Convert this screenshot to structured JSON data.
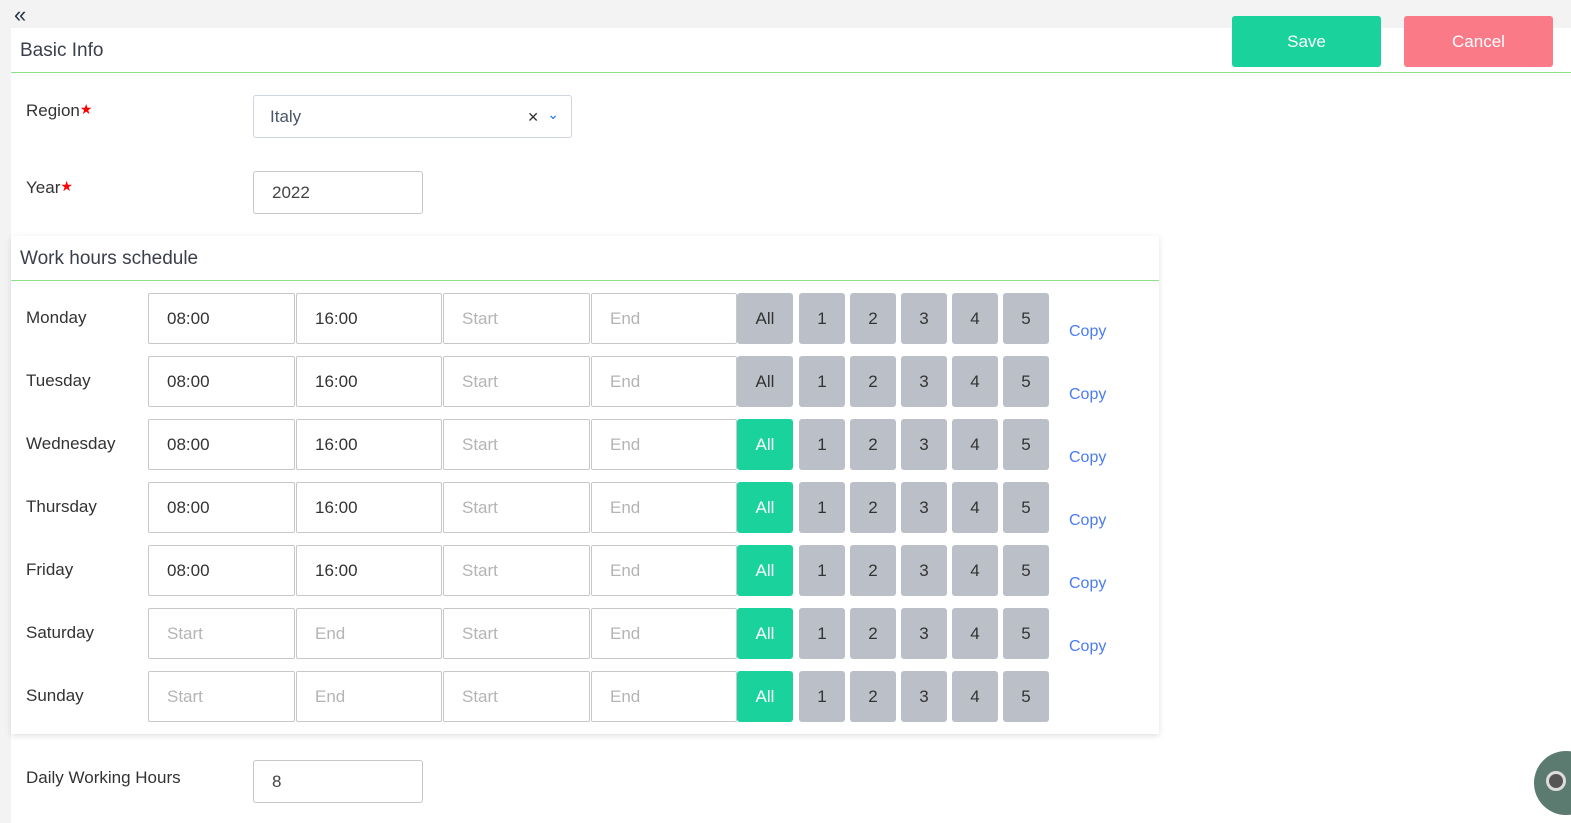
{
  "back_label": "«",
  "toolbar": {
    "save": "Save",
    "cancel": "Cancel"
  },
  "basic": {
    "title": "Basic Info",
    "region_label": "Region",
    "region_value": "Italy",
    "year_label": "Year",
    "year_value": "2022",
    "required": "★"
  },
  "schedule": {
    "title": "Work hours schedule",
    "all_label": "All",
    "weeks": [
      "1",
      "2",
      "3",
      "4",
      "5"
    ],
    "copy_label": "Copy",
    "start_placeholder": "Start",
    "end_placeholder": "End",
    "rows": [
      {
        "day": "Monday",
        "s1": "08:00",
        "e1": "16:00",
        "s2": "",
        "e2": "",
        "all_active": false,
        "copy": true
      },
      {
        "day": "Tuesday",
        "s1": "08:00",
        "e1": "16:00",
        "s2": "",
        "e2": "",
        "all_active": false,
        "copy": true
      },
      {
        "day": "Wednesday",
        "s1": "08:00",
        "e1": "16:00",
        "s2": "",
        "e2": "",
        "all_active": true,
        "copy": true
      },
      {
        "day": "Thursday",
        "s1": "08:00",
        "e1": "16:00",
        "s2": "",
        "e2": "",
        "all_active": true,
        "copy": true
      },
      {
        "day": "Friday",
        "s1": "08:00",
        "e1": "16:00",
        "s2": "",
        "e2": "",
        "all_active": true,
        "copy": true
      },
      {
        "day": "Saturday",
        "s1": "",
        "e1": "",
        "s2": "",
        "e2": "",
        "all_active": true,
        "copy": true
      },
      {
        "day": "Sunday",
        "s1": "",
        "e1": "",
        "s2": "",
        "e2": "",
        "all_active": true,
        "copy": false
      }
    ]
  },
  "daily": {
    "label": "Daily Working Hours",
    "value": "8"
  },
  "colors": {
    "accent": "#1ad29b",
    "cancel": "#fb7a88",
    "inactive": "#bbbfc8",
    "link": "#4a7cf0"
  }
}
